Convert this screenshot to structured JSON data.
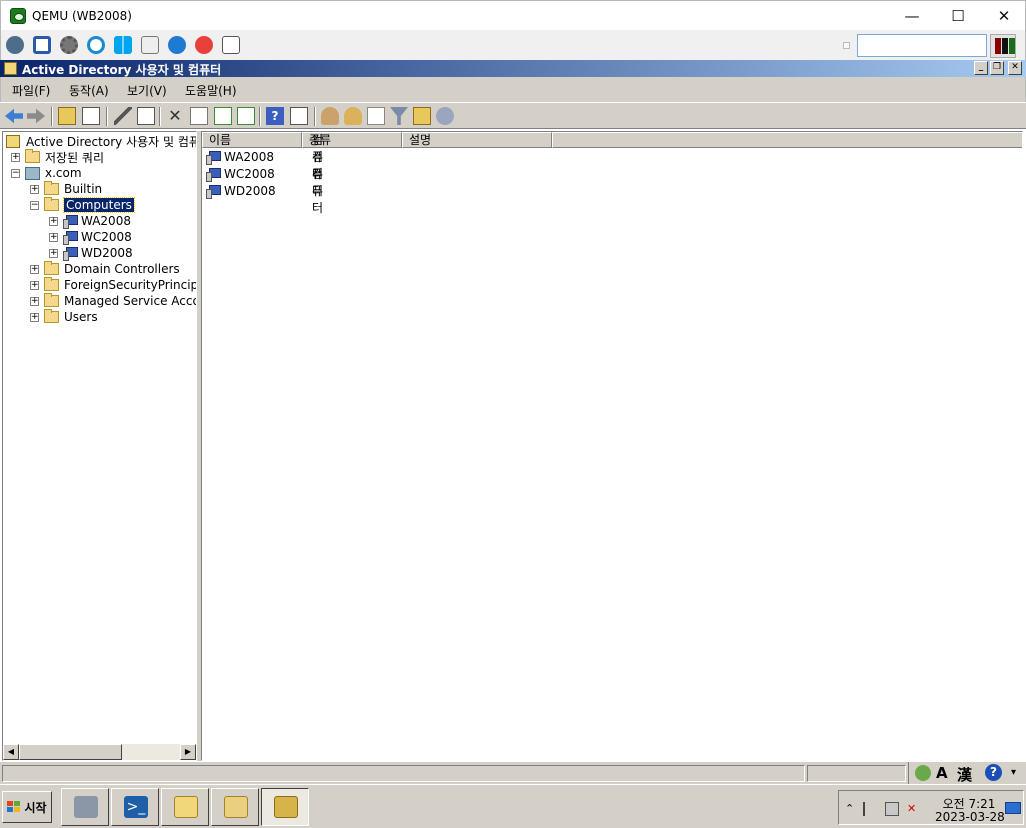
{
  "qemu": {
    "title": "QEMU (WB2008)",
    "min_glyph": "—",
    "max_glyph": "☐",
    "close_glyph": "✕",
    "toolbar_icons": [
      "vm-settings-icon",
      "fullscreen-icon",
      "gear-icon",
      "refresh-icon",
      "windows-icon",
      "terminal-icon",
      "info-icon",
      "stop-icon",
      "screenshot-icon"
    ]
  },
  "mmc": {
    "title": "Active Directory 사용자 및 컴퓨터",
    "mdi_min": "_",
    "mdi_restore": "❐",
    "mdi_close": "✕"
  },
  "menu": {
    "file": "파일(F)",
    "action": "동작(A)",
    "view": "보기(V)",
    "help": "도움말(H)"
  },
  "tree": {
    "root": "Active Directory 사용자 및 컴퓨터",
    "saved_queries": "저장된 쿼리",
    "domain": "x.com",
    "builtin": "Builtin",
    "computers": "Computers",
    "wa": "WA2008",
    "wc": "WC2008",
    "wd": "WD2008",
    "dc": "Domain Controllers",
    "fsp": "ForeignSecurityPrincipals",
    "msa": "Managed Service Accounts",
    "users": "Users"
  },
  "list": {
    "columns": [
      "이름",
      "종류",
      "설명"
    ],
    "rows": [
      {
        "name": "WA2008",
        "type": "컴퓨터"
      },
      {
        "name": "WC2008",
        "type": "컴퓨터"
      },
      {
        "name": "WD2008",
        "type": "컴퓨터"
      }
    ]
  },
  "langbar": {
    "mode_a": "A",
    "mode_han": "漢",
    "help": "?"
  },
  "taskbar": {
    "start_label": "시작",
    "clock_time": "오전 7:21",
    "clock_date": "2023-03-28"
  },
  "colors": {
    "mmc_title_start": "#0a246a",
    "mmc_title_end": "#a6caf0",
    "selection": "#0a246a",
    "chrome": "#d4d0c8"
  }
}
